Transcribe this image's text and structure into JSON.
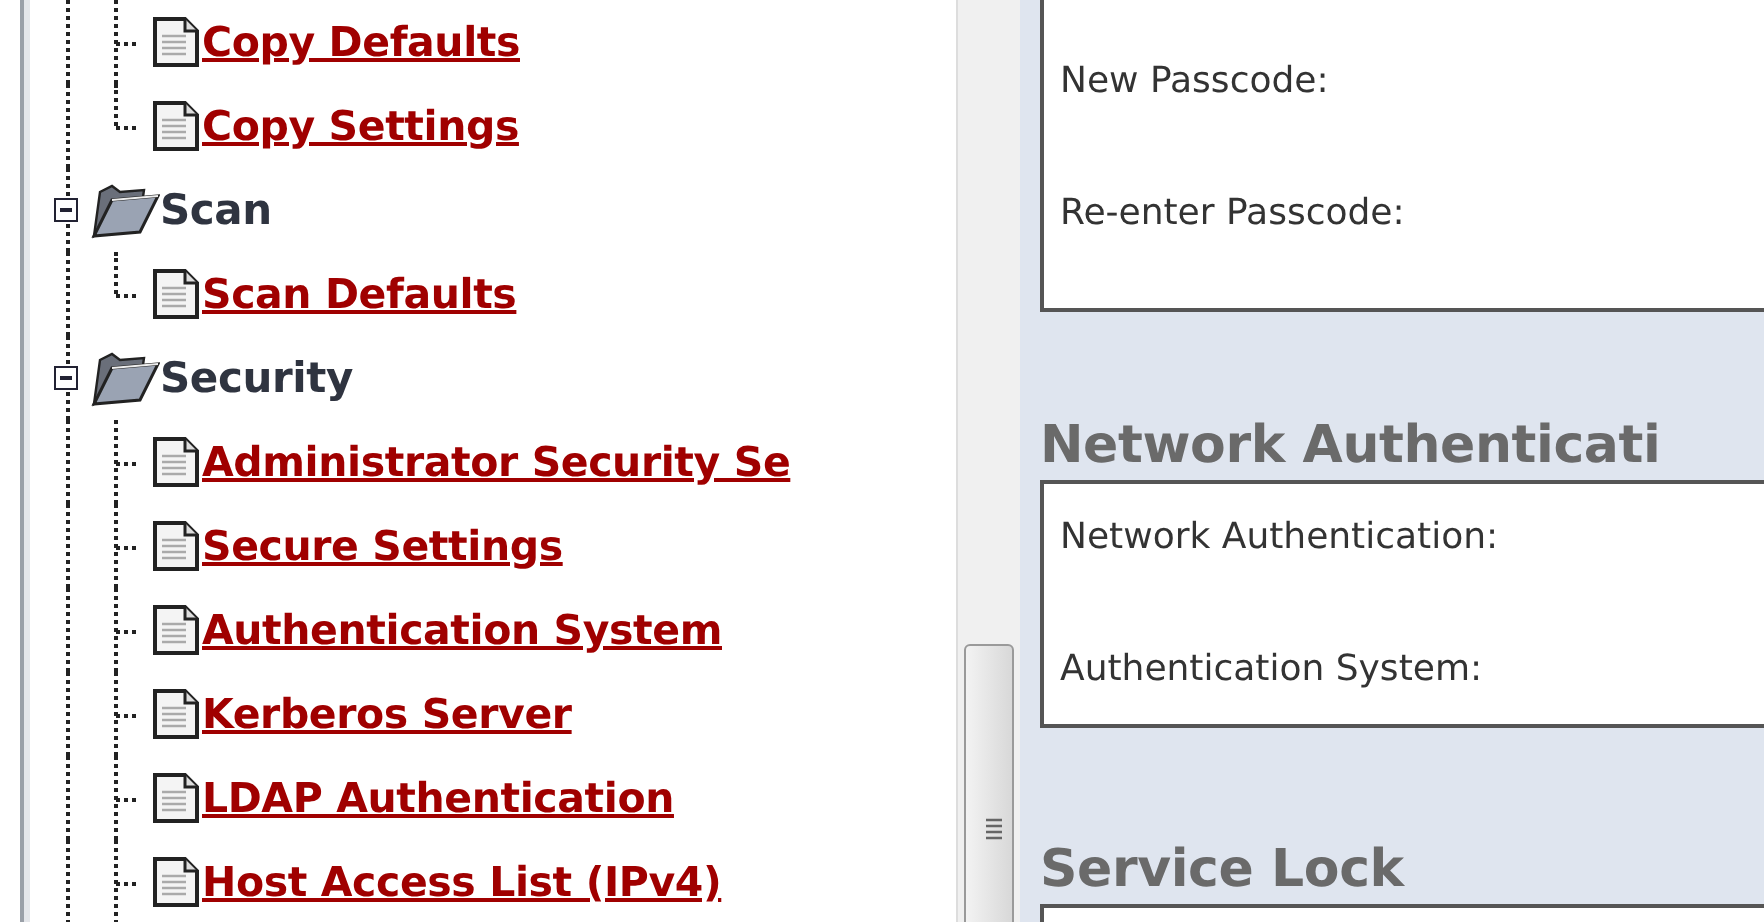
{
  "tree": {
    "continued_items": [
      {
        "label": "Copy Defaults"
      },
      {
        "label": "Copy Settings"
      }
    ],
    "folders": [
      {
        "label": "Scan",
        "expanded": true,
        "children": [
          {
            "label": "Scan Defaults"
          }
        ]
      },
      {
        "label": "Security",
        "expanded": true,
        "children": [
          {
            "label": "Administrator Security Se"
          },
          {
            "label": "Secure Settings"
          },
          {
            "label": "Authentication System"
          },
          {
            "label": "Kerberos Server"
          },
          {
            "label": "LDAP Authentication"
          },
          {
            "label": "Host Access List (IPv4)"
          }
        ]
      }
    ]
  },
  "form": {
    "sections": [
      {
        "fields": [
          {
            "label": "New Passcode:"
          },
          {
            "label": "Re-enter Passcode:"
          }
        ]
      },
      {
        "heading": "Network Authenticati",
        "fields": [
          {
            "label": "Network Authentication:"
          },
          {
            "label": "Authentication System:"
          }
        ]
      },
      {
        "heading": "Service Lock"
      }
    ]
  }
}
